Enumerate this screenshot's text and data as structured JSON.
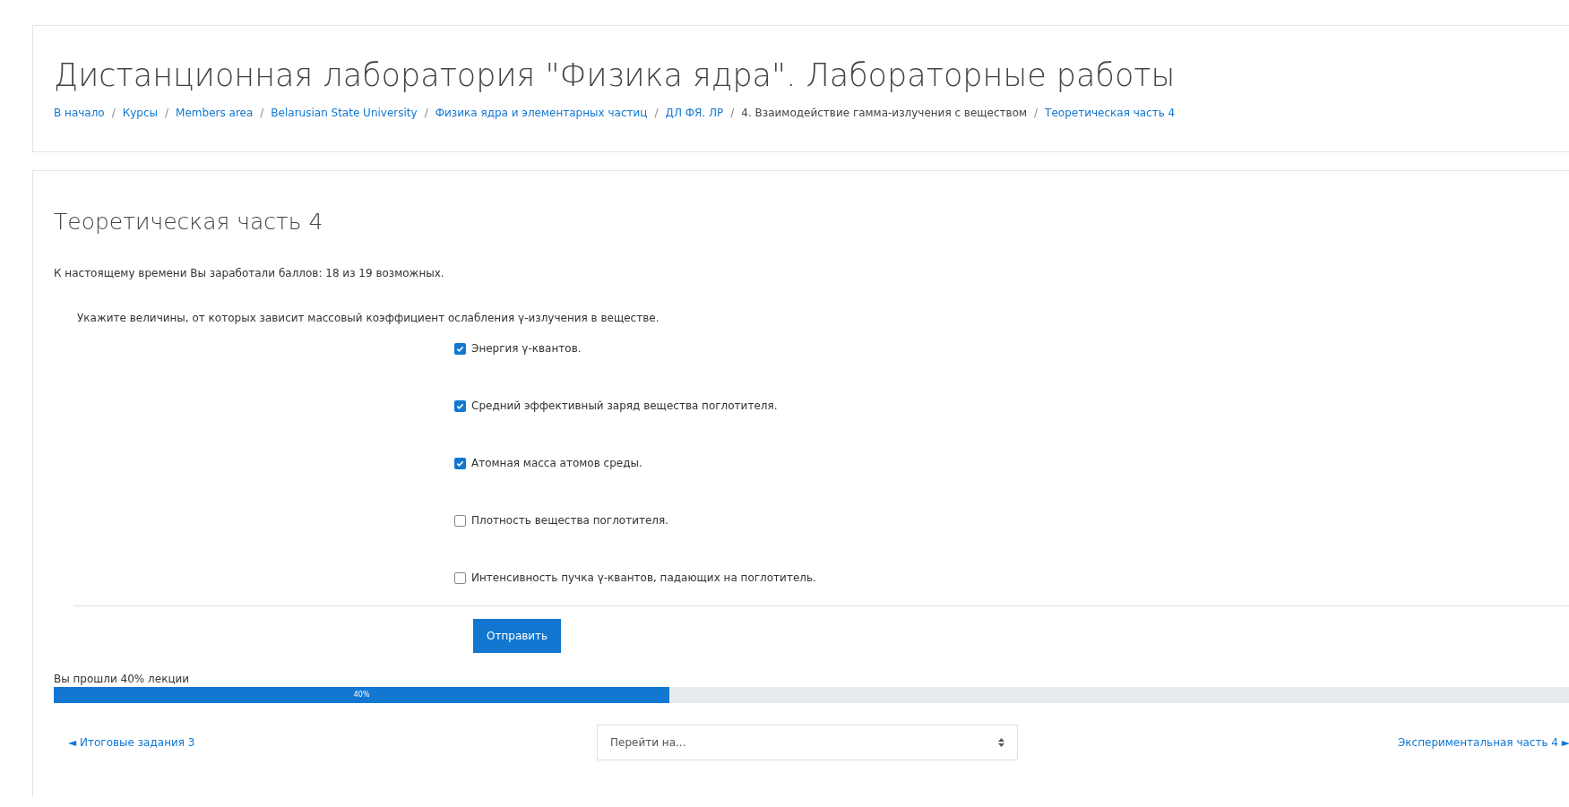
{
  "header": {
    "title": "Дистанционная лаборатория \"Физика ядра\". Лабораторные работы",
    "breadcrumb": [
      {
        "label": "В начало",
        "link": true
      },
      {
        "separator": "/",
        "label": "Курсы",
        "link": true
      },
      {
        "separator": "/",
        "label": "Members area",
        "link": true
      },
      {
        "separator": "/",
        "label": "Belarusian State University",
        "link": true
      },
      {
        "separator": "/",
        "label": "Физика ядра и элементарных частиц",
        "link": true
      },
      {
        "separator": "/",
        "label": "ДЛ ФЯ. ЛР",
        "link": true
      },
      {
        "separator": "/",
        "label": "4. Взаимодействие гамма-излучения с веществом",
        "link": false
      },
      {
        "separator": "/",
        "label": "Теоретическая часть 4",
        "link": true
      }
    ]
  },
  "page": {
    "heading": "Теоретическая часть 4",
    "score": "К настоящему времени Вы заработали баллов: 18 из 19 возможных.",
    "question": "Укажите величины, от которых зависит массовый коэффициент ослабления γ-излучения в веществе.",
    "options": [
      {
        "label": "Энергия γ-квантов.",
        "checked": true
      },
      {
        "label": "Средний эффективный заряд вещества поглотителя.",
        "checked": true
      },
      {
        "label": "Атомная масса атомов среды.",
        "checked": true
      },
      {
        "label": "Плотность вещества поглотителя.",
        "checked": false
      },
      {
        "label": "Интенсивность пучка γ-квантов, падающих на поглотитель.",
        "checked": false
      }
    ],
    "submit": "Отправить",
    "progress": {
      "label": "Вы прошли 40% лекции",
      "reading": "40%",
      "level": 0.4
    },
    "prev_link": "◄ Итоговые задания 3",
    "jump": {
      "placeholder": "Перейти на..."
    },
    "next_link": "Экспериментальная часть 4 ►"
  }
}
